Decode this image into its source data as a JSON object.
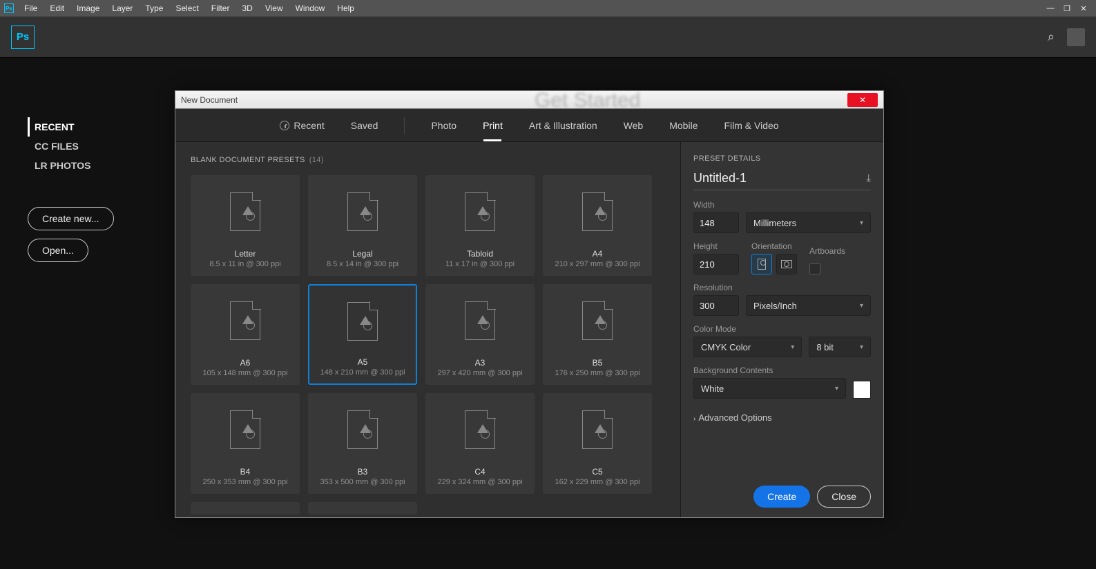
{
  "menubar": {
    "items": [
      "File",
      "Edit",
      "Image",
      "Layer",
      "Type",
      "Select",
      "Filter",
      "3D",
      "View",
      "Window",
      "Help"
    ]
  },
  "home": {
    "nav": [
      "RECENT",
      "CC FILES",
      "LR PHOTOS"
    ],
    "active": 0,
    "create_btn": "Create new...",
    "open_btn": "Open..."
  },
  "dialog": {
    "title": "New Document",
    "tabs": [
      "Recent",
      "Saved",
      "Photo",
      "Print",
      "Art & Illustration",
      "Web",
      "Mobile",
      "Film & Video"
    ],
    "active_tab": 3,
    "presets_header": "BLANK DOCUMENT PRESETS",
    "preset_count": "(14)",
    "selected_preset": 4,
    "presets": [
      {
        "name": "Letter",
        "dim": "8.5 x 11 in @ 300 ppi"
      },
      {
        "name": "Legal",
        "dim": "8.5 x 14 in @ 300 ppi"
      },
      {
        "name": "Tabloid",
        "dim": "11 x 17 in @ 300 ppi"
      },
      {
        "name": "A4",
        "dim": "210 x 297 mm @ 300 ppi"
      },
      {
        "name": "A6",
        "dim": "105 x 148 mm @ 300 ppi"
      },
      {
        "name": "A5",
        "dim": "148 x 210 mm @ 300 ppi"
      },
      {
        "name": "A3",
        "dim": "297 x 420 mm @ 300 ppi"
      },
      {
        "name": "B5",
        "dim": "176 x 250 mm @ 300 ppi"
      },
      {
        "name": "B4",
        "dim": "250 x 353 mm @ 300 ppi"
      },
      {
        "name": "B3",
        "dim": "353 x 500 mm @ 300 ppi"
      },
      {
        "name": "C4",
        "dim": "229 x 324 mm @ 300 ppi"
      },
      {
        "name": "C5",
        "dim": "162 x 229 mm @ 300 ppi"
      }
    ],
    "details": {
      "section": "PRESET DETAILS",
      "docname": "Untitled-1",
      "width_label": "Width",
      "width": "148",
      "unit": "Millimeters",
      "height_label": "Height",
      "height": "210",
      "orientation_label": "Orientation",
      "artboards_label": "Artboards",
      "resolution_label": "Resolution",
      "resolution": "300",
      "res_unit": "Pixels/Inch",
      "colormode_label": "Color Mode",
      "colormode": "CMYK Color",
      "depth": "8 bit",
      "bg_label": "Background Contents",
      "bg": "White",
      "adv": "Advanced Options",
      "create": "Create",
      "close": "Close"
    }
  }
}
